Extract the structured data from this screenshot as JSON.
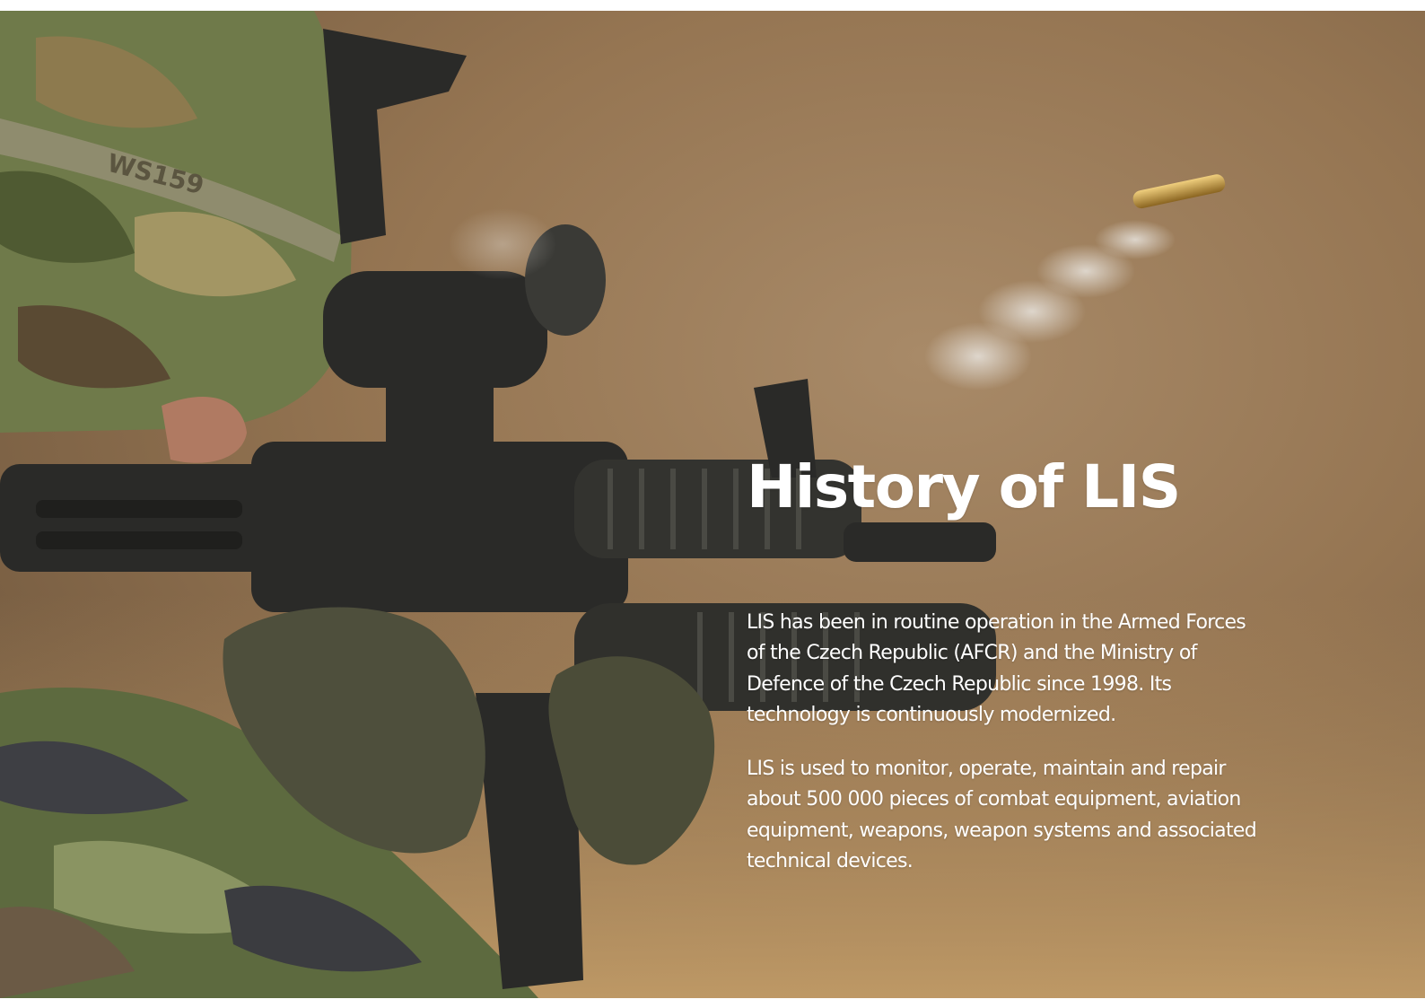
{
  "slide": {
    "title": "History of LIS",
    "paragraphs": [
      "LIS has been in routine operation in the Armed Forces\nof the Czech Republic (AFCR) and the Ministry of\nDefence of the Czech Republic since 1998. Its\ntechnology is continuously modernized.",
      "LIS is used to monitor, operate, maintain and repair\nabout  500 000 pieces of combat equipment, aviation\nequipment, weapons, weapon systems and associated\ntechnical devices."
    ],
    "image": {
      "helmet_marking": "WS159"
    }
  },
  "colors": {
    "background_sand": "#9c7c57",
    "text": "#ffffff",
    "camo_green": "#6f7a4a",
    "rifle_black": "#2a2a28"
  }
}
